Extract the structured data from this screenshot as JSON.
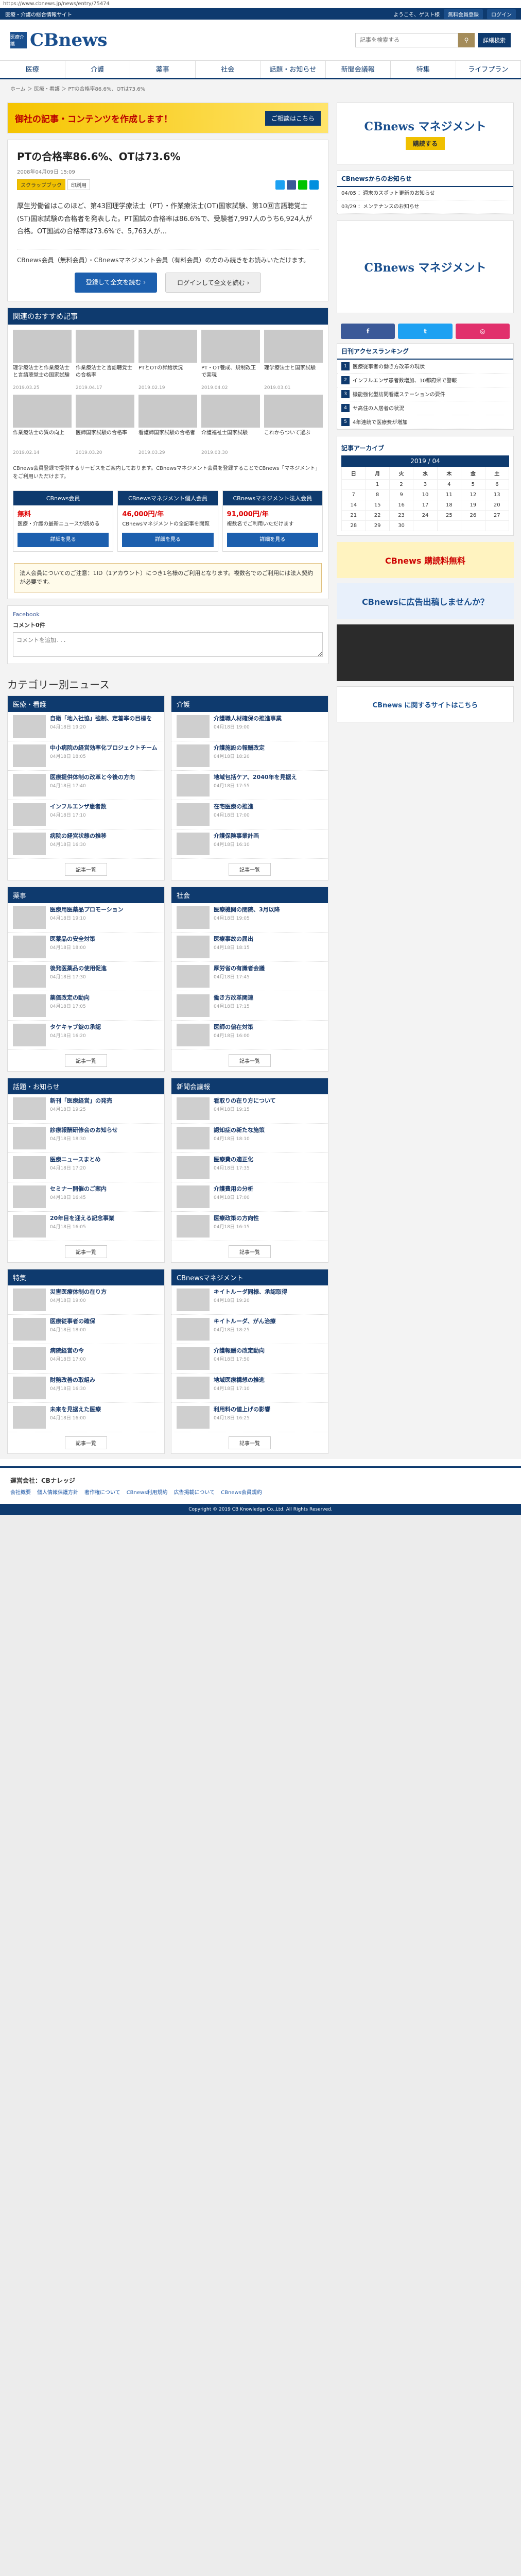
{
  "url": "https://www.cbnews.jp/news/entry/75474",
  "topbar": {
    "title": "医療・介護の総合情報サイト",
    "welcome": "ようこそ、ゲスト様",
    "register": "無料会員登録",
    "login": "ログイン"
  },
  "header": {
    "logo_mark": "医療介護",
    "logo_word": "CBnews",
    "search_placeholder": "記事を検索する",
    "advanced": "詳細検索"
  },
  "nav": [
    "医療",
    "介護",
    "薬事",
    "社会",
    "話題・お知らせ",
    "新聞会議報",
    "特集",
    "ライフプラン"
  ],
  "breadcrumb": "ホーム ＞ 医療・看護 ＞ PTの合格率86.6%、OTは73.6%",
  "ad_banner": {
    "text": "御社の記事・コンテンツを作成します！",
    "cta": "ご相談はこちら"
  },
  "article": {
    "title": "PTの合格率86.6%、OTは73.6%",
    "date": "2008年04月09日 15:09",
    "tag1": "スクラップブック",
    "tag2": "印刷用",
    "body": "厚生労働省はこのほど、第43回理学療法士（PT）・作業療法士(OT)国家試験、第10回言語聴覚士(ST)国家試験の合格者を発表した。PT国試の合格率は86.6%で、受験者7,997人のうち6,924人が合格。OT国試の合格率は73.6%で、5,763人が…",
    "paygate": "CBnews会員（無料会員）・CBnewsマネジメント会員（有料会員）の方のみ続きをお読みいただけます。",
    "btn_register": "登録して全文を読む ›",
    "btn_login": "ログインして全文を読む ›"
  },
  "rec": {
    "heading": "関連のおすすめ記事",
    "items": [
      {
        "t": "理学療法士と作業療法士と言語聴覚士の国家試験",
        "d": "2019.03.25"
      },
      {
        "t": "作業療法士と言語聴覚士の合格率",
        "d": "2019.04.17"
      },
      {
        "t": "PTとOTの昇給状況",
        "d": "2019.02.19"
      },
      {
        "t": "PT・OT養成、規制改正で実現",
        "d": "2019.04.02"
      },
      {
        "t": "理学療法士と国家試験",
        "d": "2019.03.01"
      },
      {
        "t": "作業療法士の質の向上",
        "d": "2019.02.14"
      },
      {
        "t": "医師国家試験の合格率",
        "d": "2019.03.20"
      },
      {
        "t": "看護師国家試験の合格者",
        "d": "2019.03.29"
      },
      {
        "t": "介護福祉士国家試験",
        "d": "2019.03.30"
      },
      {
        "t": "これからついて選ぶ",
        "d": ""
      }
    ]
  },
  "note": "CBnews会員登録で提供するサービスをご案内しております。CBnewsマネジメント会員を登録することでCBnews「マネジメント」をご利用いただけます。",
  "plans": [
    {
      "head": "CBnews会員",
      "price": "無料",
      "desc": "医療・介護の最新ニュースが読める",
      "btn": "詳細を見る"
    },
    {
      "head": "CBnewsマネジメント個人会員",
      "price": "46,000円/年",
      "desc": "CBnewsマネジメントの全記事を閲覧",
      "btn": "詳細を見る"
    },
    {
      "head": "CBnewsマネジメント法人会員",
      "price": "91,000円/年",
      "desc": "複数名でご利用いただけます",
      "btn": "詳細を見る"
    }
  ],
  "warn": "法人会員についてのご注意：1ID（1アカウント）につき1名様のご利用となります。複数名でのご利用には法人契約が必要です。",
  "fb": {
    "label": "Facebook",
    "count": "コメント0件",
    "placeholder": "コメントを追加..."
  },
  "category": {
    "heading": "カテゴリー別ニュース",
    "more": "記事一覧",
    "blocks": [
      {
        "name": "医療・看護",
        "items": [
          {
            "t": "自衛「地入社協」強制、定着率の目標を",
            "d": "04月18日 19:20"
          },
          {
            "t": "中小病院の経営効率化プロジェクトチーム",
            "d": "04月18日 18:05"
          },
          {
            "t": "医療提供体制の改革と今後の方向",
            "d": "04月18日 17:40"
          },
          {
            "t": "インフルエンザ患者数",
            "d": "04月18日 17:10"
          },
          {
            "t": "病院の経営状態の推移",
            "d": "04月18日 16:30"
          }
        ]
      },
      {
        "name": "介護",
        "items": [
          {
            "t": "介護職人材確保の推進事業",
            "d": "04月18日 19:00"
          },
          {
            "t": "介護施設の報酬改定",
            "d": "04月18日 18:20"
          },
          {
            "t": "地域包括ケア、2040年を見据え",
            "d": "04月18日 17:55"
          },
          {
            "t": "在宅医療の推進",
            "d": "04月18日 17:00"
          },
          {
            "t": "介護保険事業計画",
            "d": "04月18日 16:10"
          }
        ]
      },
      {
        "name": "薬事",
        "items": [
          {
            "t": "医療用医薬品プロモーション",
            "d": "04月18日 19:10"
          },
          {
            "t": "医薬品の安全対策",
            "d": "04月18日 18:00"
          },
          {
            "t": "後発医薬品の使用促進",
            "d": "04月18日 17:30"
          },
          {
            "t": "薬価改定の動向",
            "d": "04月18日 17:05"
          },
          {
            "t": "タケキャブ錠の承認",
            "d": "04月18日 16:20"
          }
        ]
      },
      {
        "name": "社会",
        "items": [
          {
            "t": "医療機関の閉院、3月以降",
            "d": "04月18日 19:05"
          },
          {
            "t": "医療事故の届出",
            "d": "04月18日 18:15"
          },
          {
            "t": "厚労省の有識者会議",
            "d": "04月18日 17:45"
          },
          {
            "t": "働き方改革関連",
            "d": "04月18日 17:15"
          },
          {
            "t": "医師の偏在対策",
            "d": "04月18日 16:00"
          }
        ]
      },
      {
        "name": "話題・お知らせ",
        "items": [
          {
            "t": "新刊「医療経営」の発売",
            "d": "04月18日 19:25"
          },
          {
            "t": "診療報酬研修会のお知らせ",
            "d": "04月18日 18:30"
          },
          {
            "t": "医療ニュースまとめ",
            "d": "04月18日 17:20"
          },
          {
            "t": "セミナー開催のご案内",
            "d": "04月18日 16:45"
          },
          {
            "t": "20年目を迎える記念事業",
            "d": "04月18日 16:05"
          }
        ]
      },
      {
        "name": "新聞会議報",
        "items": [
          {
            "t": "看取りの在り方について",
            "d": "04月18日 19:15"
          },
          {
            "t": "認知症の新たな施策",
            "d": "04月18日 18:10"
          },
          {
            "t": "医療費の適正化",
            "d": "04月18日 17:35"
          },
          {
            "t": "介護費用の分析",
            "d": "04月18日 17:00"
          },
          {
            "t": "医療政策の方向性",
            "d": "04月18日 16:15"
          }
        ]
      },
      {
        "name": "特集",
        "items": [
          {
            "t": "災害医療体制の在り方",
            "d": "04月18日 19:00"
          },
          {
            "t": "医療従事者の確保",
            "d": "04月18日 18:00"
          },
          {
            "t": "病院経営の今",
            "d": "04月18日 17:00"
          },
          {
            "t": "財務改善の取組み",
            "d": "04月18日 16:30"
          },
          {
            "t": "未来を見据えた医療",
            "d": "04月18日 16:00"
          }
        ]
      },
      {
        "name": "CBnewsマネジメント",
        "items": [
          {
            "t": "キイトルーダ同様、承認取得",
            "d": "04月18日 19:20"
          },
          {
            "t": "キイトルーダ、がん治療",
            "d": "04月18日 18:25"
          },
          {
            "t": "介護報酬の改定動向",
            "d": "04月18日 17:50"
          },
          {
            "t": "地域医療構想の推進",
            "d": "04月18日 17:10"
          },
          {
            "t": "利用料の値上げの影響",
            "d": "04月18日 16:25"
          }
        ]
      }
    ]
  },
  "side": {
    "ad_l1": "CBnews マネジメント",
    "ad_l2": "購読する",
    "notice_h": "CBnewsからのお知らせ",
    "notices": [
      "04/05 ：週末のスポット更新のお知らせ",
      "03/29 ：メンテナンスのお知らせ"
    ],
    "rank_h": "日刊アクセスランキング",
    "ranks": [
      "医療従事者の働き方改革の現状",
      "インフルエンザ患者数増加、10都府県で警報",
      "機能強化型訪問看護ステーションの要件",
      "サ高住の入居者の状況",
      "4年連続で医療費が増加"
    ],
    "cal_h": "記事アーカイブ",
    "cal_m": "2019 / 04",
    "cal_dow": [
      "日",
      "月",
      "火",
      "水",
      "木",
      "金",
      "土"
    ],
    "cal_rows": [
      [
        "",
        "1",
        "2",
        "3",
        "4",
        "5",
        "6"
      ],
      [
        "7",
        "8",
        "9",
        "10",
        "11",
        "12",
        "13"
      ],
      [
        "14",
        "15",
        "16",
        "17",
        "18",
        "19",
        "20"
      ],
      [
        "21",
        "22",
        "23",
        "24",
        "25",
        "26",
        "27"
      ],
      [
        "28",
        "29",
        "30",
        "",
        "",
        "",
        ""
      ]
    ],
    "b1": "CBnews 購読料無料",
    "b2": "CBnewsに広告出稿しませんか？",
    "b3": "CBnews に関するサイトはこちら"
  },
  "footer": {
    "h": "運営会社：CBナレッジ",
    "links": [
      "会社概要",
      "個人情報保護方針",
      "著作権について",
      "CBnews利用規約",
      "広告掲載について",
      "CBnews会員規約"
    ],
    "copy": "Copyright © 2019 CB Knowledge Co.,Ltd. All Rights Reserved."
  }
}
